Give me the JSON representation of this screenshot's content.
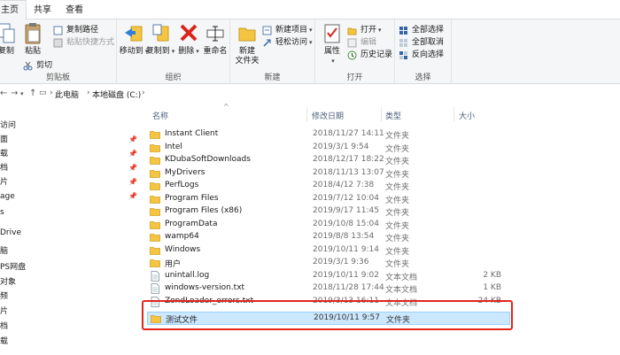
{
  "ribbon_tabs": [
    {
      "label": "主页"
    },
    {
      "label": "共享"
    },
    {
      "label": "查看"
    }
  ],
  "clipboard": {
    "copy": "复制",
    "paste": "粘贴",
    "copy_path": "复制路径",
    "paste_shortcut": "粘贴快捷方式",
    "cut": "剪切",
    "group_label": "剪贴板"
  },
  "organize": {
    "move_to": "移动到",
    "copy_to": "复制到",
    "delete": "删除",
    "rename": "重命名",
    "group_label": "组织"
  },
  "new_group": {
    "new_folder_line1": "新建",
    "new_folder_line2": "文件夹",
    "new_item": "新建项目",
    "easy_access": "轻松访问",
    "group_label": "新建"
  },
  "open_group": {
    "properties": "属性",
    "open": "打开",
    "edit": "编辑",
    "history": "历史记录",
    "group_label": "打开"
  },
  "select_group": {
    "select_all": "全部选择",
    "select_none": "全部取消",
    "invert": "反向选择",
    "group_label": "选择"
  },
  "address": {
    "crumbs": [
      "此电脑",
      "本地磁盘 (C:)"
    ]
  },
  "nav_pane": {
    "items": [
      {
        "label": "访问",
        "pinned": false
      },
      {
        "label": "面",
        "pinned": true
      },
      {
        "label": "载",
        "pinned": true
      },
      {
        "label": "档",
        "pinned": true
      },
      {
        "label": "片",
        "pinned": true
      },
      {
        "label": "age",
        "pinned": true
      },
      {
        "label": "s",
        "pinned": false
      },
      {
        "label": "Drive",
        "pinned": false
      },
      {
        "label": "脑",
        "pinned": false
      },
      {
        "label": "PS网盘",
        "pinned": false
      },
      {
        "label": "对象",
        "pinned": false
      },
      {
        "label": "频",
        "pinned": false
      },
      {
        "label": "片",
        "pinned": false
      },
      {
        "label": "档",
        "pinned": false
      },
      {
        "label": "载",
        "pinned": false
      }
    ]
  },
  "columns": {
    "name": "名称",
    "modified": "修改日期",
    "type": "类型",
    "size": "大小"
  },
  "files": [
    {
      "name": "Instant Client",
      "date": "2018/11/27 14:11",
      "type": "文件夹",
      "size": "",
      "icon": "folder-icon"
    },
    {
      "name": "Intel",
      "date": "2019/3/1 9:54",
      "type": "文件夹",
      "size": "",
      "icon": "folder-icon"
    },
    {
      "name": "KDubaSoftDownloads",
      "date": "2018/12/17 18:22",
      "type": "文件夹",
      "size": "",
      "icon": "folder-icon"
    },
    {
      "name": "MyDrivers",
      "date": "2018/11/13 13:07",
      "type": "文件夹",
      "size": "",
      "icon": "folder-icon"
    },
    {
      "name": "PerfLogs",
      "date": "2018/4/12 7:38",
      "type": "文件夹",
      "size": "",
      "icon": "folder-icon"
    },
    {
      "name": "Program Files",
      "date": "2019/7/12 10:04",
      "type": "文件夹",
      "size": "",
      "icon": "folder-icon"
    },
    {
      "name": "Program Files (x86)",
      "date": "2019/9/17 11:45",
      "type": "文件夹",
      "size": "",
      "icon": "folder-icon"
    },
    {
      "name": "ProgramData",
      "date": "2019/10/8 15:04",
      "type": "文件夹",
      "size": "",
      "icon": "folder-icon"
    },
    {
      "name": "wamp64",
      "date": "2019/8/8 13:54",
      "type": "文件夹",
      "size": "",
      "icon": "folder-icon"
    },
    {
      "name": "Windows",
      "date": "2019/10/11 9:14",
      "type": "文件夹",
      "size": "",
      "icon": "folder-icon"
    },
    {
      "name": "用户",
      "date": "2019/3/1 9:36",
      "type": "文件夹",
      "size": "",
      "icon": "folder-icon"
    },
    {
      "name": "unintall.log",
      "date": "2019/10/11 9:02",
      "type": "文本文档",
      "size": "2 KB",
      "icon": "text-file-icon"
    },
    {
      "name": "windows-version.txt",
      "date": "2018/11/28 17:44",
      "type": "文本文档",
      "size": "1 KB",
      "icon": "text-file-icon"
    },
    {
      "name": "ZondLoader_errors.txt",
      "date": "2019/3/13 16:11",
      "type": "文本文档",
      "size": "24 KB",
      "icon": "text-file-icon"
    },
    {
      "name": "测试文件",
      "date": "2019/10/11 9:57",
      "type": "文件夹",
      "size": "",
      "icon": "folder-icon",
      "selected": true
    }
  ],
  "colors": {
    "selection_bg": "#cce8ff",
    "highlight_box": "#e2241b",
    "folder": "#f5c542"
  }
}
